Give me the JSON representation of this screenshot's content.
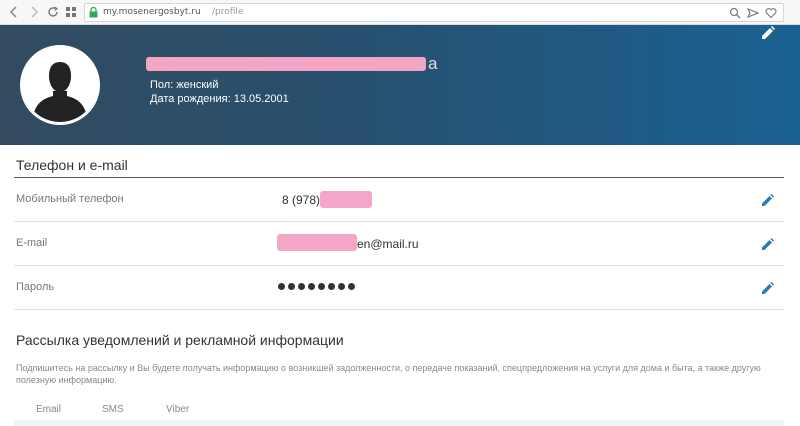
{
  "browser": {
    "url_domain": "my.mosenergosbyt.ru",
    "url_path": "/profile"
  },
  "header": {
    "name_visible_tail": "а",
    "gender": "Пол: женский",
    "birthdate": "Дата рождения: 13.05.2001"
  },
  "contacts": {
    "section_title": "Телефон и e-mail",
    "rows": [
      {
        "label": "Мобильный телефон",
        "value": "8 (978)"
      },
      {
        "label": "E-mail",
        "value": "en@mail.ru"
      },
      {
        "label": "Пароль",
        "value": "●●●●●●●●"
      }
    ]
  },
  "subscription": {
    "section_title": "Рассылка уведомлений и рекламной информации",
    "description": "Подпишитесь на рассылку и Вы будете получать информацию о возникшей задолженности, о передаче показаний, спецпредложения на услуги для дома и быта, а также другую полезную информацию.",
    "channels": [
      "Email",
      "SMS",
      "Viber"
    ]
  },
  "icons": {
    "back": "back-icon",
    "forward": "forward-icon",
    "refresh": "refresh-icon",
    "apps": "apps-grid-icon",
    "lock": "lock-icon",
    "search": "search-icon",
    "share": "share-icon",
    "favorite": "heart-icon",
    "edit": "pencil-icon",
    "avatar": "user-silhouette-icon"
  },
  "colors": {
    "header_start": "#334b5f",
    "header_end": "#1a6293",
    "accent": "#2a7ab8",
    "secure": "#34a853"
  }
}
